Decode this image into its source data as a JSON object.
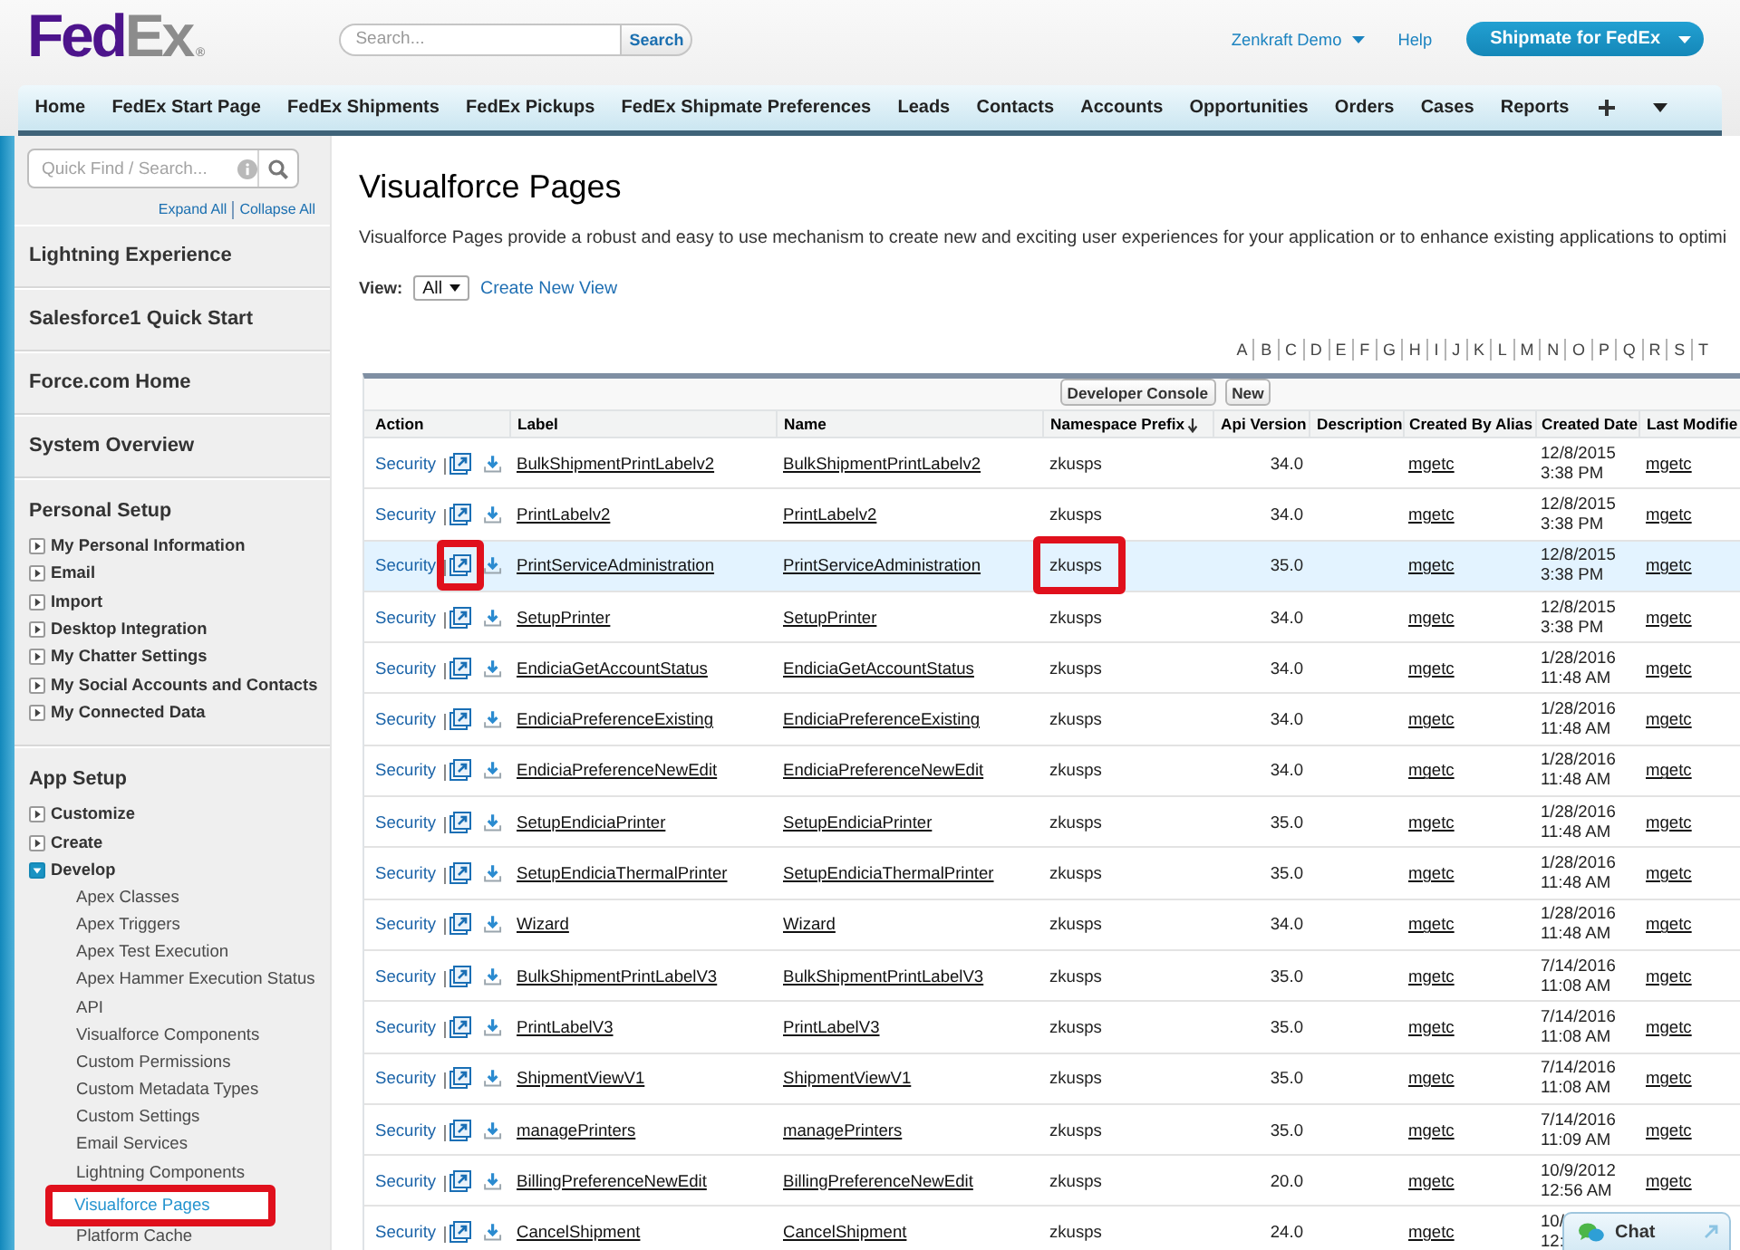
{
  "header": {
    "logo": [
      "Fed",
      "Ex"
    ],
    "logo_mark": "®",
    "search": {
      "placeholder": "Search...",
      "button": "Search"
    },
    "user_menu": "Zenkraft Demo",
    "help": "Help",
    "app_button": "Shipmate for FedEx"
  },
  "tabs": [
    "Home",
    "FedEx Start Page",
    "FedEx Shipments",
    "FedEx Pickups",
    "FedEx Shipmate Preferences",
    "Leads",
    "Contacts",
    "Accounts",
    "Opportunities",
    "Orders",
    "Cases",
    "Reports"
  ],
  "sidebar": {
    "quick_find": {
      "placeholder": "Quick Find / Search..."
    },
    "expand_all": "Expand All",
    "collapse_all": "Collapse All",
    "sections": [
      {
        "kind": "link",
        "label": "Lightning Experience"
      },
      {
        "kind": "link",
        "label": "Salesforce1 Quick Start"
      },
      {
        "kind": "link",
        "label": "Force.com Home"
      },
      {
        "kind": "link",
        "label": "System Overview"
      },
      {
        "kind": "group",
        "label": "Personal Setup",
        "items": [
          {
            "label": "My Personal Information",
            "expanded": false
          },
          {
            "label": "Email",
            "expanded": false
          },
          {
            "label": "Import",
            "expanded": false
          },
          {
            "label": "Desktop Integration",
            "expanded": false
          },
          {
            "label": "My Chatter Settings",
            "expanded": false
          },
          {
            "label": "My Social Accounts and Contacts",
            "expanded": false
          },
          {
            "label": "My Connected Data",
            "expanded": false
          }
        ]
      },
      {
        "kind": "group",
        "label": "App Setup",
        "items": [
          {
            "label": "Customize",
            "expanded": false
          },
          {
            "label": "Create",
            "expanded": false
          },
          {
            "label": "Develop",
            "expanded": true,
            "children": [
              {
                "label": "Apex Classes",
                "selected": false,
                "callout": false
              },
              {
                "label": "Apex Triggers",
                "selected": false,
                "callout": false
              },
              {
                "label": "Apex Test Execution",
                "selected": false,
                "callout": false
              },
              {
                "label": "Apex Hammer Execution Status",
                "selected": false,
                "callout": false
              },
              {
                "label": "API",
                "selected": false,
                "callout": false
              },
              {
                "label": "Visualforce Components",
                "selected": false,
                "callout": false
              },
              {
                "label": "Custom Permissions",
                "selected": false,
                "callout": false
              },
              {
                "label": "Custom Metadata Types",
                "selected": false,
                "callout": false
              },
              {
                "label": "Custom Settings",
                "selected": false,
                "callout": false
              },
              {
                "label": "Email Services",
                "selected": false,
                "callout": false
              },
              {
                "label": "Lightning Components",
                "selected": false,
                "callout": false
              },
              {
                "label": "Visualforce Pages",
                "selected": true,
                "callout": true
              },
              {
                "label": "Platform Cache",
                "selected": false,
                "callout": false
              }
            ]
          }
        ]
      }
    ]
  },
  "page": {
    "title": "Visualforce Pages",
    "description": "Visualforce Pages provide a robust and easy to use mechanism to create new and exciting user experiences for your application or to enhance existing applications to optimi",
    "view": {
      "label": "View:",
      "value": "All",
      "link": "Create New View"
    },
    "letters": [
      "A",
      "B",
      "C",
      "D",
      "E",
      "F",
      "G",
      "H",
      "I",
      "J",
      "K",
      "L",
      "M",
      "N",
      "O",
      "P",
      "Q",
      "R",
      "S",
      "T"
    ],
    "buttons": [
      "Developer Console",
      "New"
    ],
    "columns": [
      {
        "label": "Action",
        "sorted": false
      },
      {
        "label": "Label",
        "sorted": false
      },
      {
        "label": "Name",
        "sorted": false
      },
      {
        "label": "Namespace Prefix",
        "sorted": true
      },
      {
        "label": "Api Version",
        "sorted": false
      },
      {
        "label": "Description",
        "sorted": false
      },
      {
        "label": "Created By Alias",
        "sorted": false
      },
      {
        "label": "Created Date",
        "sorted": false
      },
      {
        "label": "Last Modifie",
        "sorted": false
      }
    ],
    "rows": [
      {
        "action": "Security",
        "label": "BulkShipmentPrintLabelv2",
        "name": "BulkShipmentPrintLabelv2",
        "prefix": "zkusps",
        "api_version": "34.0",
        "created_by": "mgetc",
        "created_date": "12/8/2015",
        "created_time": "3:38 PM",
        "modified_by": "mgetc",
        "highlighted": false,
        "icon_callout": false,
        "prefix_callout": false
      },
      {
        "action": "Security",
        "label": "PrintLabelv2",
        "name": "PrintLabelv2",
        "prefix": "zkusps",
        "api_version": "34.0",
        "created_by": "mgetc",
        "created_date": "12/8/2015",
        "created_time": "3:38 PM",
        "modified_by": "mgetc",
        "highlighted": false,
        "icon_callout": false,
        "prefix_callout": false
      },
      {
        "action": "Security",
        "label": "PrintServiceAdministration",
        "name": "PrintServiceAdministration",
        "prefix": "zkusps",
        "api_version": "35.0",
        "created_by": "mgetc",
        "created_date": "12/8/2015",
        "created_time": "3:38 PM",
        "modified_by": "mgetc",
        "highlighted": true,
        "icon_callout": true,
        "prefix_callout": true
      },
      {
        "action": "Security",
        "label": "SetupPrinter",
        "name": "SetupPrinter",
        "prefix": "zkusps",
        "api_version": "34.0",
        "created_by": "mgetc",
        "created_date": "12/8/2015",
        "created_time": "3:38 PM",
        "modified_by": "mgetc",
        "highlighted": false,
        "icon_callout": false,
        "prefix_callout": false
      },
      {
        "action": "Security",
        "label": "EndiciaGetAccountStatus",
        "name": "EndiciaGetAccountStatus",
        "prefix": "zkusps",
        "api_version": "34.0",
        "created_by": "mgetc",
        "created_date": "1/28/2016",
        "created_time": "11:48 AM",
        "modified_by": "mgetc",
        "highlighted": false,
        "icon_callout": false,
        "prefix_callout": false
      },
      {
        "action": "Security",
        "label": "EndiciaPreferenceExisting",
        "name": "EndiciaPreferenceExisting",
        "prefix": "zkusps",
        "api_version": "34.0",
        "created_by": "mgetc",
        "created_date": "1/28/2016",
        "created_time": "11:48 AM",
        "modified_by": "mgetc",
        "highlighted": false,
        "icon_callout": false,
        "prefix_callout": false
      },
      {
        "action": "Security",
        "label": "EndiciaPreferenceNewEdit",
        "name": "EndiciaPreferenceNewEdit",
        "prefix": "zkusps",
        "api_version": "34.0",
        "created_by": "mgetc",
        "created_date": "1/28/2016",
        "created_time": "11:48 AM",
        "modified_by": "mgetc",
        "highlighted": false,
        "icon_callout": false,
        "prefix_callout": false
      },
      {
        "action": "Security",
        "label": "SetupEndiciaPrinter",
        "name": "SetupEndiciaPrinter",
        "prefix": "zkusps",
        "api_version": "35.0",
        "created_by": "mgetc",
        "created_date": "1/28/2016",
        "created_time": "11:48 AM",
        "modified_by": "mgetc",
        "highlighted": false,
        "icon_callout": false,
        "prefix_callout": false
      },
      {
        "action": "Security",
        "label": "SetupEndiciaThermalPrinter",
        "name": "SetupEndiciaThermalPrinter",
        "prefix": "zkusps",
        "api_version": "35.0",
        "created_by": "mgetc",
        "created_date": "1/28/2016",
        "created_time": "11:48 AM",
        "modified_by": "mgetc",
        "highlighted": false,
        "icon_callout": false,
        "prefix_callout": false
      },
      {
        "action": "Security",
        "label": "Wizard",
        "name": "Wizard",
        "prefix": "zkusps",
        "api_version": "34.0",
        "created_by": "mgetc",
        "created_date": "1/28/2016",
        "created_time": "11:48 AM",
        "modified_by": "mgetc",
        "highlighted": false,
        "icon_callout": false,
        "prefix_callout": false
      },
      {
        "action": "Security",
        "label": "BulkShipmentPrintLabelV3",
        "name": "BulkShipmentPrintLabelV3",
        "prefix": "zkusps",
        "api_version": "35.0",
        "created_by": "mgetc",
        "created_date": "7/14/2016",
        "created_time": "11:08 AM",
        "modified_by": "mgetc",
        "highlighted": false,
        "icon_callout": false,
        "prefix_callout": false
      },
      {
        "action": "Security",
        "label": "PrintLabelV3",
        "name": "PrintLabelV3",
        "prefix": "zkusps",
        "api_version": "35.0",
        "created_by": "mgetc",
        "created_date": "7/14/2016",
        "created_time": "11:08 AM",
        "modified_by": "mgetc",
        "highlighted": false,
        "icon_callout": false,
        "prefix_callout": false
      },
      {
        "action": "Security",
        "label": "ShipmentViewV1",
        "name": "ShipmentViewV1",
        "prefix": "zkusps",
        "api_version": "35.0",
        "created_by": "mgetc",
        "created_date": "7/14/2016",
        "created_time": "11:08 AM",
        "modified_by": "mgetc",
        "highlighted": false,
        "icon_callout": false,
        "prefix_callout": false
      },
      {
        "action": "Security",
        "label": "managePrinters",
        "name": "managePrinters",
        "prefix": "zkusps",
        "api_version": "35.0",
        "created_by": "mgetc",
        "created_date": "7/14/2016",
        "created_time": "11:09 AM",
        "modified_by": "mgetc",
        "highlighted": false,
        "icon_callout": false,
        "prefix_callout": false
      },
      {
        "action": "Security",
        "label": "BillingPreferenceNewEdit",
        "name": "BillingPreferenceNewEdit",
        "prefix": "zkusps",
        "api_version": "20.0",
        "created_by": "mgetc",
        "created_date": "10/9/2012",
        "created_time": "12:56 AM",
        "modified_by": "mgetc",
        "highlighted": false,
        "icon_callout": false,
        "prefix_callout": false
      },
      {
        "action": "Security",
        "label": "CancelShipment",
        "name": "CancelShipment",
        "prefix": "zkusps",
        "api_version": "24.0",
        "created_by": "mgetc",
        "created_date": "10/",
        "created_time": "12:",
        "highlighted": false,
        "icon_callout": false,
        "prefix_callout": false
      }
    ]
  },
  "chat": {
    "label": "Chat"
  }
}
